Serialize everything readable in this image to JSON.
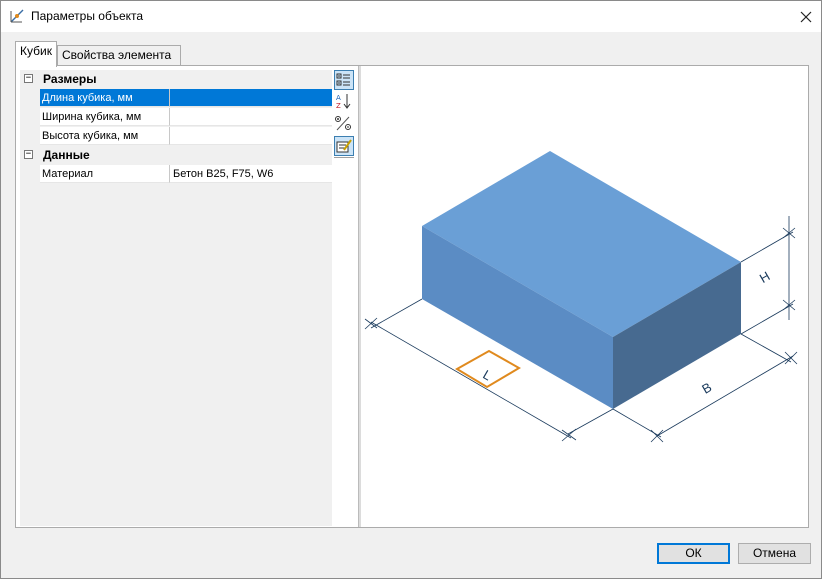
{
  "window": {
    "title": "Параметры объекта",
    "icon": "dimensions-icon"
  },
  "tabs": [
    {
      "label": "Кубик",
      "active": true
    },
    {
      "label": "Свойства элемента",
      "active": false
    }
  ],
  "grid": {
    "categories": [
      {
        "label": "Размеры",
        "toggle": "⊟",
        "properties": [
          {
            "name": "Длина кубика, мм",
            "value": "",
            "selected": true
          },
          {
            "name": "Ширина кубика, мм",
            "value": ""
          },
          {
            "name": "Высота кубика, мм",
            "value": ""
          }
        ]
      },
      {
        "label": "Данные",
        "toggle": "⊟",
        "properties": [
          {
            "name": "Материал",
            "value": "Бетон B25, F75, W6"
          }
        ]
      }
    ]
  },
  "toolbar": {
    "buttons": [
      "categorized-view-icon",
      "alphabetical-sort-icon",
      "expand-collapse-icon",
      "property-pages-icon"
    ]
  },
  "preview": {
    "dimension_labels": {
      "length": "L",
      "width": "B",
      "height": "H"
    },
    "colors": {
      "top": "#6a9fd6",
      "left": "#5b8cc4",
      "right": "#476a90",
      "dims": "#1a3a5c",
      "marker": "#e08a1e"
    }
  },
  "buttons": {
    "ok": "ОК",
    "cancel": "Отмена"
  }
}
